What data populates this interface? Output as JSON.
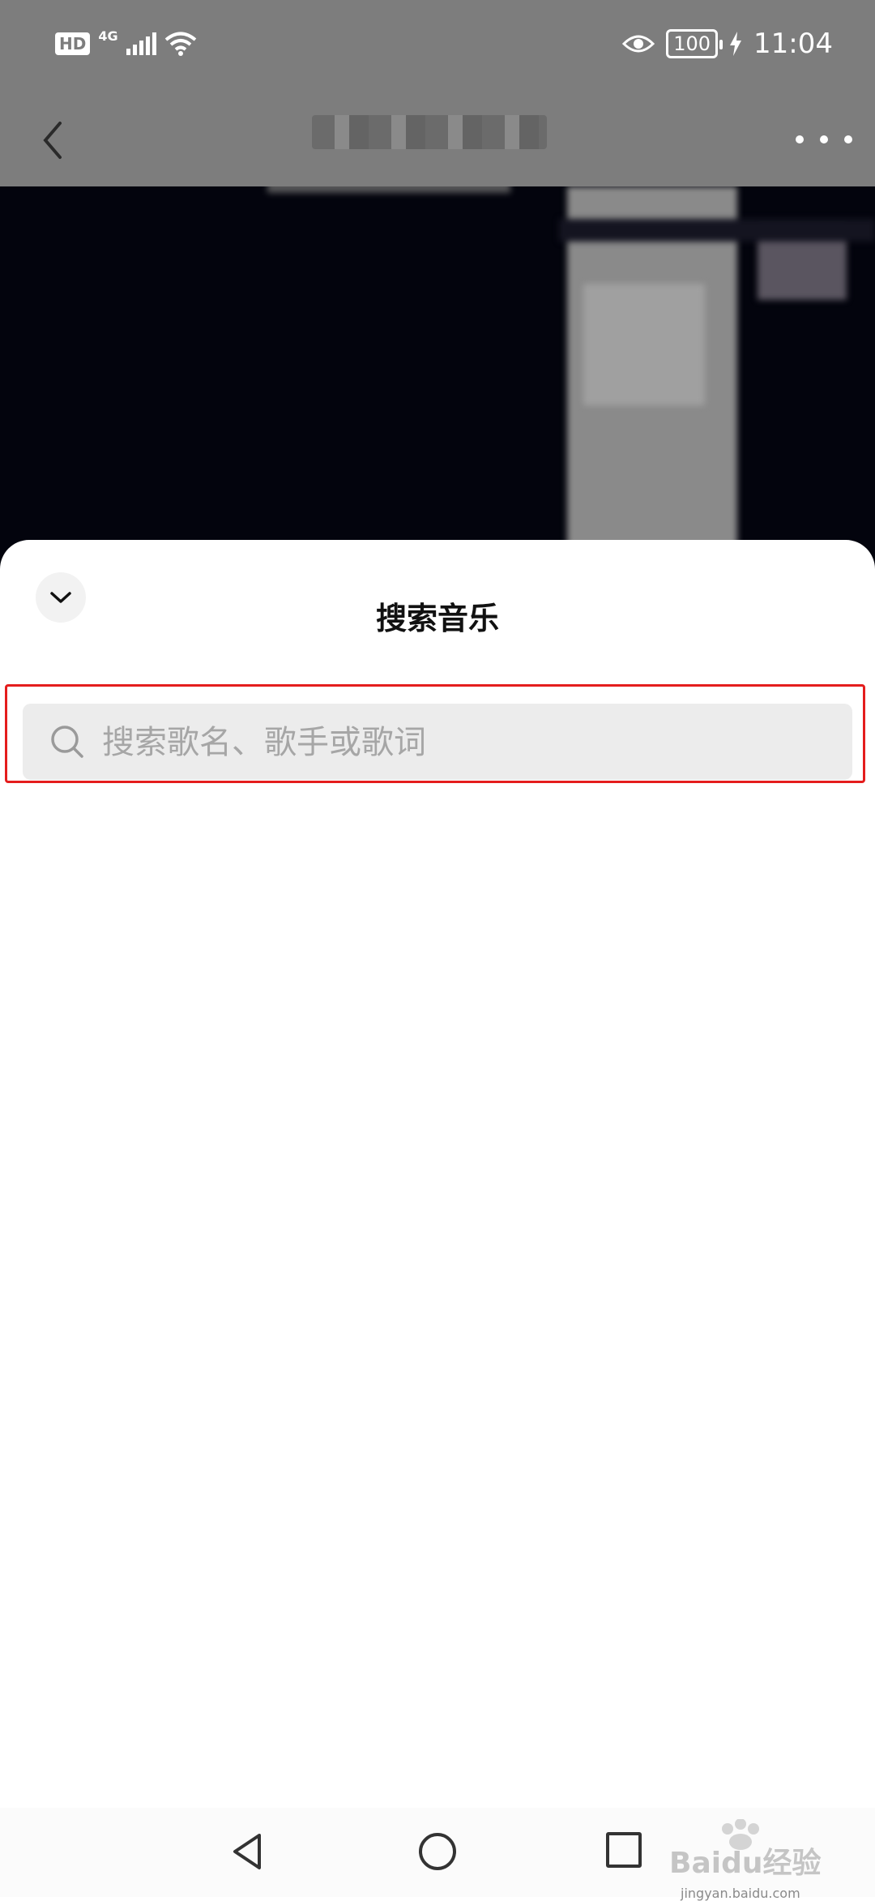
{
  "status_bar": {
    "hd_badge": "HD",
    "network_type": "4G",
    "battery_level": "100",
    "time": "11:04"
  },
  "search_sheet": {
    "title": "搜索音乐",
    "search_placeholder": "搜索歌名、歌手或歌词"
  },
  "watermark": {
    "brand": "Baidu经验",
    "url": "jingyan.baidu.com"
  },
  "colors": {
    "highlight_border": "#e41d1d",
    "search_bg": "#ececec",
    "placeholder": "#a6a6a6"
  }
}
